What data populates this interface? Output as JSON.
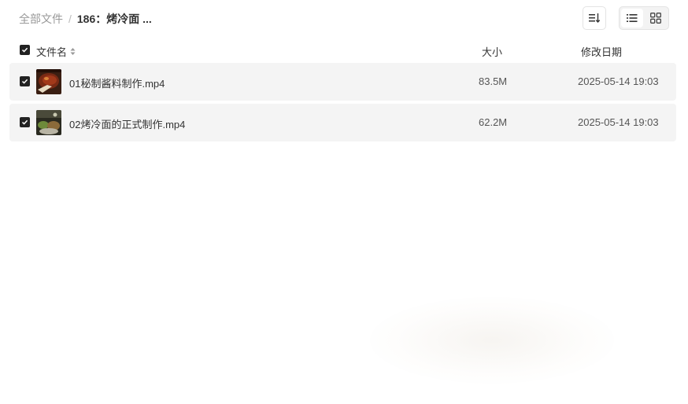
{
  "breadcrumb": {
    "root": "全部文件",
    "separator": "/",
    "current": "186：烤冷面 ..."
  },
  "toolbar": {
    "sort_icon": "sort-icon",
    "list_view_icon": "list-view-icon",
    "grid_view_icon": "grid-view-icon",
    "active_view": "list"
  },
  "table": {
    "header": {
      "name": "文件名",
      "size": "大小",
      "date": "修改日期"
    },
    "rows": [
      {
        "name": "01秘制酱料制作.mp4",
        "size": "83.5M",
        "date": "2025-05-14 19:03",
        "checked": true
      },
      {
        "name": "02烤冷面的正式制作.mp4",
        "size": "62.2M",
        "date": "2025-05-14 19:03",
        "checked": true
      }
    ]
  },
  "colors": {
    "row_background": "#f4f4f4",
    "checkbox": "#222222",
    "muted_text": "#999999"
  }
}
